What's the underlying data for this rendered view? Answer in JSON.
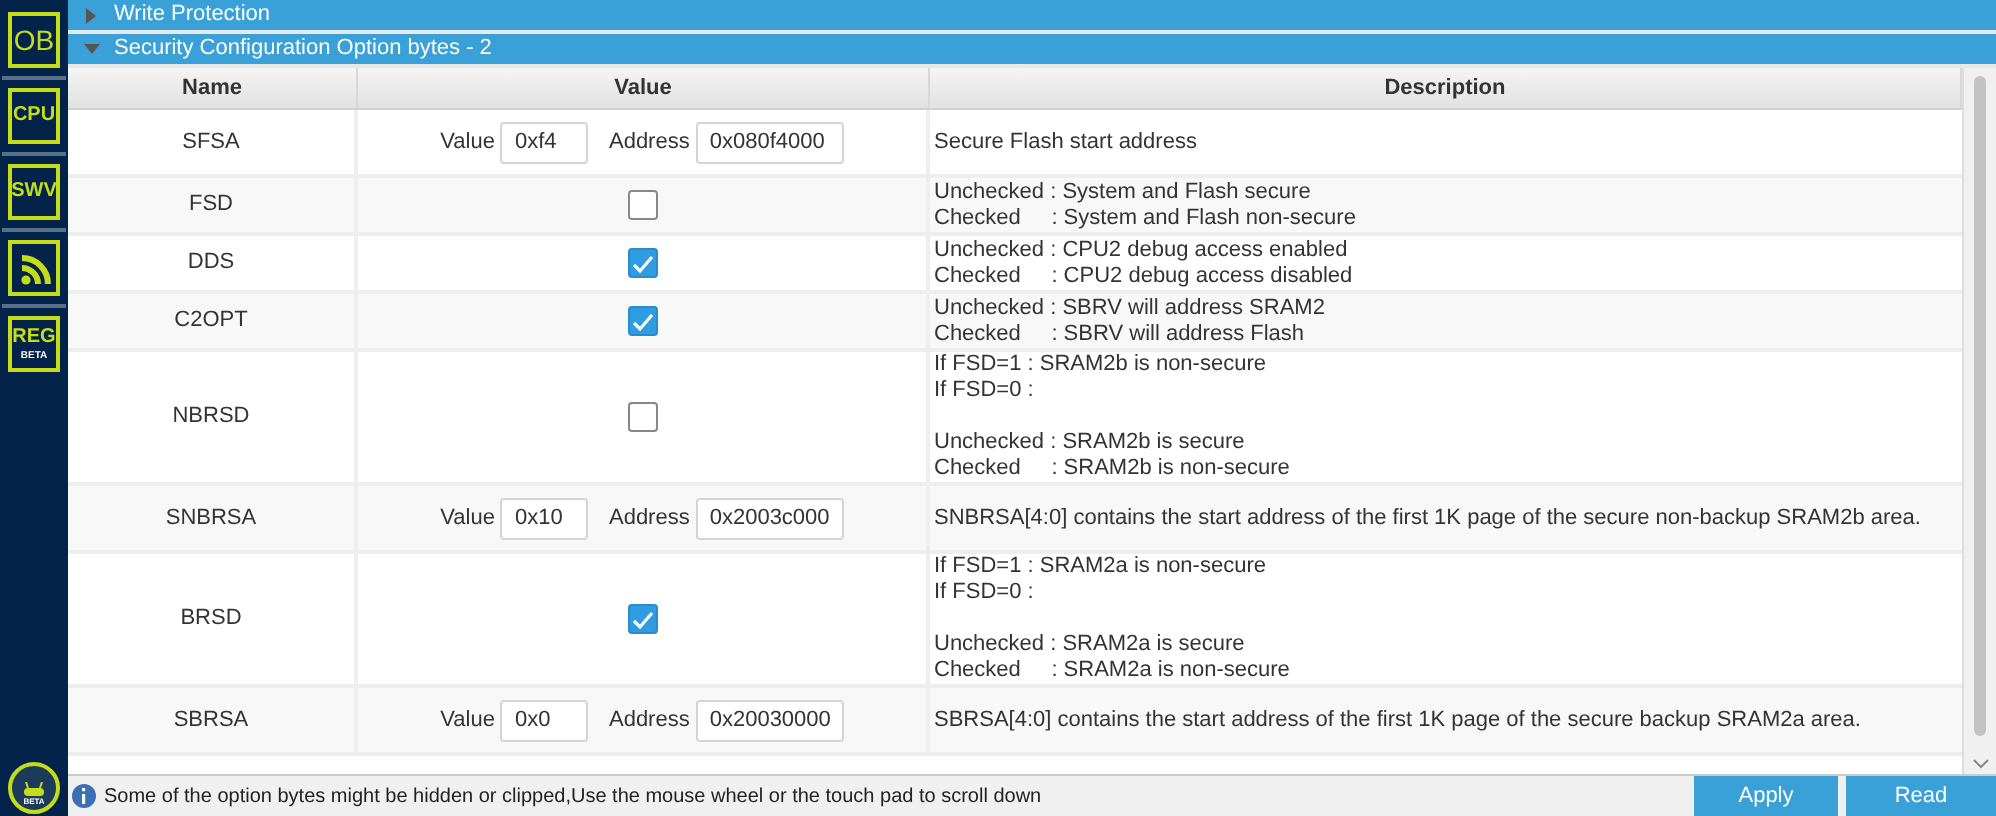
{
  "sidebar": {
    "items": [
      {
        "kind": "text",
        "label": "OB"
      },
      {
        "kind": "text",
        "label": "CPU"
      },
      {
        "kind": "text",
        "label": "SWV"
      },
      {
        "kind": "wifi"
      },
      {
        "kind": "text",
        "label": "REG",
        "sub": "BETA"
      }
    ],
    "bottom_badge": "BETA"
  },
  "sections": [
    {
      "title": "Write Protection",
      "expanded": false
    },
    {
      "title": "Security Configuration Option bytes - 2",
      "expanded": true
    }
  ],
  "table": {
    "columns": [
      "Name",
      "Value",
      "Description"
    ],
    "rows": [
      {
        "name": "SFSA",
        "kind": "value",
        "value_label": "Value",
        "value": "0xf4",
        "address_label": "Address",
        "address": "0x080f4000",
        "description": [
          [
            "Secure Flash start address"
          ]
        ]
      },
      {
        "name": "FSD",
        "kind": "checkbox",
        "checked": false,
        "description": [
          [
            "Unchecked : System and Flash secure",
            "Checked     : System and Flash non-secure"
          ]
        ]
      },
      {
        "name": "DDS",
        "kind": "checkbox",
        "checked": true,
        "description": [
          [
            "Unchecked : CPU2 debug access enabled",
            "Checked     : CPU2 debug access disabled"
          ]
        ]
      },
      {
        "name": "C2OPT",
        "kind": "checkbox",
        "checked": true,
        "description": [
          [
            "Unchecked : SBRV will address SRAM2",
            "Checked     : SBRV will address Flash"
          ]
        ]
      },
      {
        "name": "NBRSD",
        "kind": "checkbox",
        "checked": false,
        "description": [
          [
            "If FSD=1 : SRAM2b is non-secure",
            "If FSD=0 :"
          ],
          [
            "Unchecked : SRAM2b is secure",
            "Checked     : SRAM2b is non-secure"
          ]
        ]
      },
      {
        "name": "SNBRSA",
        "kind": "value",
        "value_label": "Value",
        "value": "0x10",
        "address_label": "Address",
        "address": "0x2003c000",
        "description": [
          [
            "SNBRSA[4:0] contains the start address of the first 1K page of the secure non-backup SRAM2b area."
          ]
        ]
      },
      {
        "name": "BRSD",
        "kind": "checkbox",
        "checked": true,
        "description": [
          [
            "If FSD=1 : SRAM2a is non-secure",
            "If FSD=0 :"
          ],
          [
            "Unchecked : SRAM2a is secure",
            "Checked     : SRAM2a is non-secure"
          ]
        ]
      },
      {
        "name": "SBRSA",
        "kind": "value",
        "value_label": "Value",
        "value": "0x0",
        "address_label": "Address",
        "address": "0x20030000",
        "description": [
          [
            "SBRSA[4:0] contains the start address of the first 1K page of the secure backup SRAM2a area."
          ]
        ]
      }
    ]
  },
  "status_bar": {
    "message": "Some of the option bytes might be hidden or clipped,Use the mouse wheel or the touch pad to scroll down",
    "buttons": [
      "Apply",
      "Read"
    ]
  }
}
